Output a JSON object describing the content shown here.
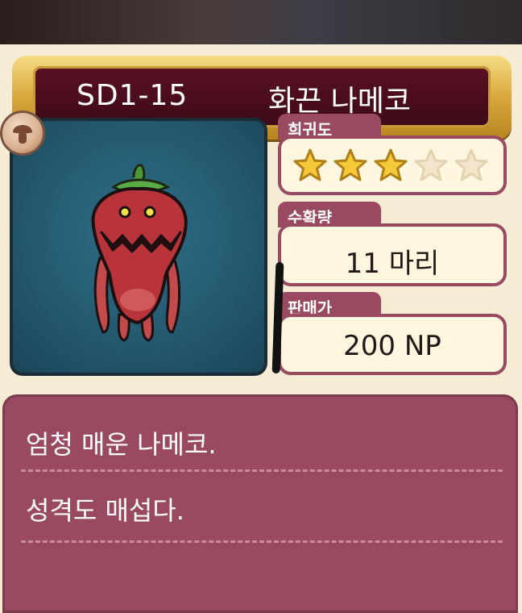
{
  "title_banner": {
    "code": "SD1-15",
    "name": "화끈 나메코"
  },
  "creature": {
    "icon": "red-pepper-nameko-creature",
    "badge_icon": "mushroom-badge-icon"
  },
  "rarity": {
    "label": "희귀도",
    "stars_filled": 3,
    "stars_total": 5
  },
  "harvest": {
    "label": "수확량",
    "value": "11 마리"
  },
  "sale_price": {
    "label": "판매가",
    "value": "200 NP"
  },
  "description": {
    "lines": [
      "엄청 매운 나메코.",
      "성격도 매섭다."
    ]
  },
  "colors": {
    "panel": "#9a4a60",
    "banner": "#3d0a17",
    "gold": "#d8a73b",
    "card": "#f6ecd6"
  }
}
